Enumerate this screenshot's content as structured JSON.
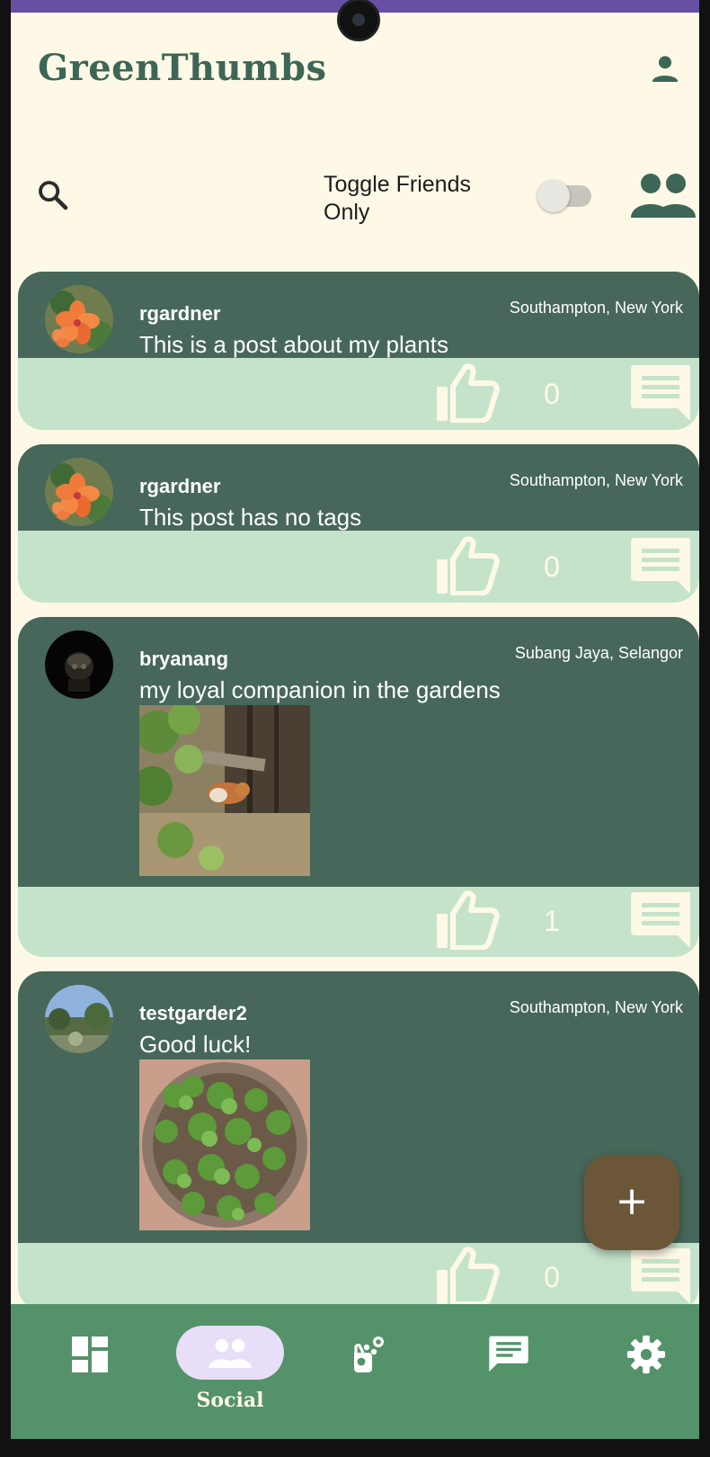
{
  "app": {
    "brand": "GreenThumbs"
  },
  "filters": {
    "toggle_label": "Toggle Friends Only",
    "friends_only": false
  },
  "posts": [
    {
      "username": "rgardner",
      "location": "Southampton, New York",
      "text": "This is a post about my plants",
      "likes": "0",
      "has_image": false
    },
    {
      "username": "rgardner",
      "location": "Southampton, New York",
      "text": "This post has no tags",
      "likes": "0",
      "has_image": false
    },
    {
      "username": "bryanang",
      "location": "Subang Jaya, Selangor",
      "text": "my loyal companion in the gardens",
      "likes": "1",
      "has_image": true
    },
    {
      "username": "testgarder2",
      "location": "Southampton, New York",
      "text": "Good luck!",
      "likes": "0",
      "has_image": true
    }
  ],
  "fab": {
    "icon": "plus-icon",
    "label": "+"
  },
  "nav": {
    "items": [
      {
        "icon": "dashboard-icon",
        "label": ""
      },
      {
        "icon": "group-icon",
        "label": "Social",
        "active": true
      },
      {
        "icon": "plants-icon",
        "label": ""
      },
      {
        "icon": "chat-icon",
        "label": ""
      },
      {
        "icon": "gear-icon",
        "label": ""
      }
    ]
  },
  "colors": {
    "background": "#fef9e6",
    "card_header": "#466759",
    "card_footer": "#c5e3cb",
    "brand": "#3d6656",
    "nav_bar": "#54926a",
    "nav_active_pill": "#e8def8",
    "fab": "#6b5637",
    "status_bar": "#6750a4"
  }
}
